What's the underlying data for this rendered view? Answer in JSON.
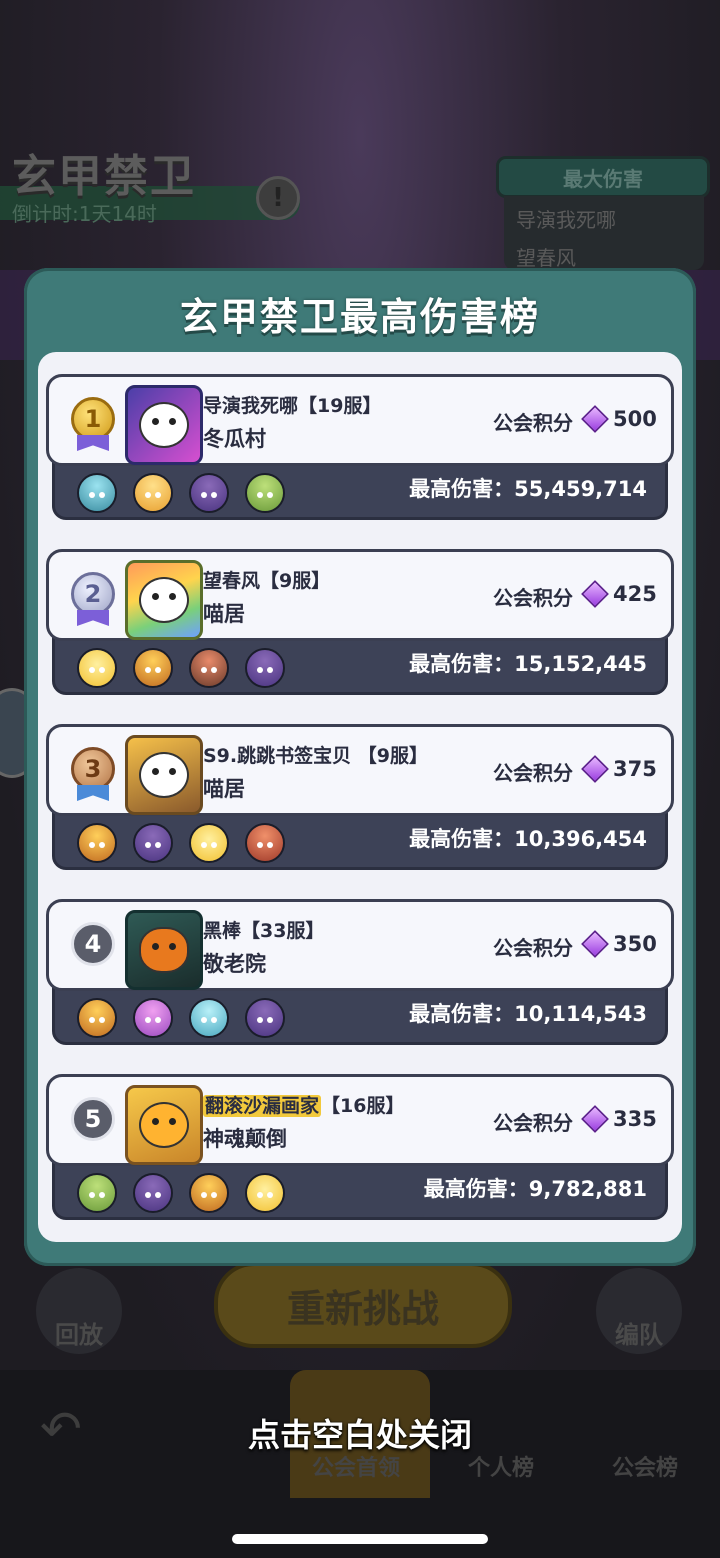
{
  "background": {
    "boss_title": "玄甲禁卫",
    "countdown": "倒计时:1天14时",
    "max_damage_header": "最大伤害",
    "max_damage_rows": [
      "导演我死哪",
      "望春风"
    ],
    "replay_label": "回放",
    "retry_label": "重新挑战",
    "team_label": "编队",
    "nav": {
      "guild_leader": "公会首领",
      "personal_rank": "个人榜",
      "guild_rank": "公会榜"
    }
  },
  "modal": {
    "title": "玄甲禁卫最高伤害榜",
    "points_label": "公会积分",
    "damage_label": "最高伤害：",
    "entries": [
      {
        "rank": "1",
        "medal": "gold",
        "player": "导演我死哪【19服】",
        "guild": "冬瓜村",
        "points": "500",
        "damage": "55,459,714",
        "team_icons": [
          "teal-hero-icon",
          "yellow-hero-icon",
          "purple-hero-icon",
          "green-hero-icon"
        ]
      },
      {
        "rank": "2",
        "medal": "silver",
        "player": "望春风【9服】",
        "guild": "喵居",
        "points": "425",
        "damage": "15,152,445",
        "team_icons": [
          "chick-hero-icon",
          "fire-hero-icon",
          "girl-hero-icon",
          "purple-hero-icon"
        ]
      },
      {
        "rank": "3",
        "medal": "bronze",
        "player": "S9.跳跳书签宝贝 【9服】",
        "guild": "喵居",
        "points": "375",
        "damage": "10,396,454",
        "team_icons": [
          "fire-hero-icon",
          "purple-hero-icon",
          "chick-hero-icon",
          "red-hero-icon"
        ]
      },
      {
        "rank": "4",
        "medal": "plain",
        "player": "黑棒【33服】",
        "guild": "敬老院",
        "points": "350",
        "damage": "10,114,543",
        "team_icons": [
          "fire-hero-icon",
          "pink-hero-icon",
          "cyan-hero-icon",
          "purple-hero-icon"
        ]
      },
      {
        "rank": "5",
        "medal": "plain",
        "player_highlight": "翻滚沙漏画家",
        "player_server": "【16服】",
        "guild": "神魂颠倒",
        "points": "335",
        "damage": "9,782,881",
        "team_icons": [
          "green-hero-icon",
          "purple-hero-icon",
          "fire-hero-icon",
          "chick-hero-icon"
        ]
      }
    ]
  },
  "close_hint": "点击空白处关闭",
  "colors": {
    "modal_frame": "#3f7a78",
    "card_dark": "#3d4257",
    "gem": "#9b3fe0"
  }
}
